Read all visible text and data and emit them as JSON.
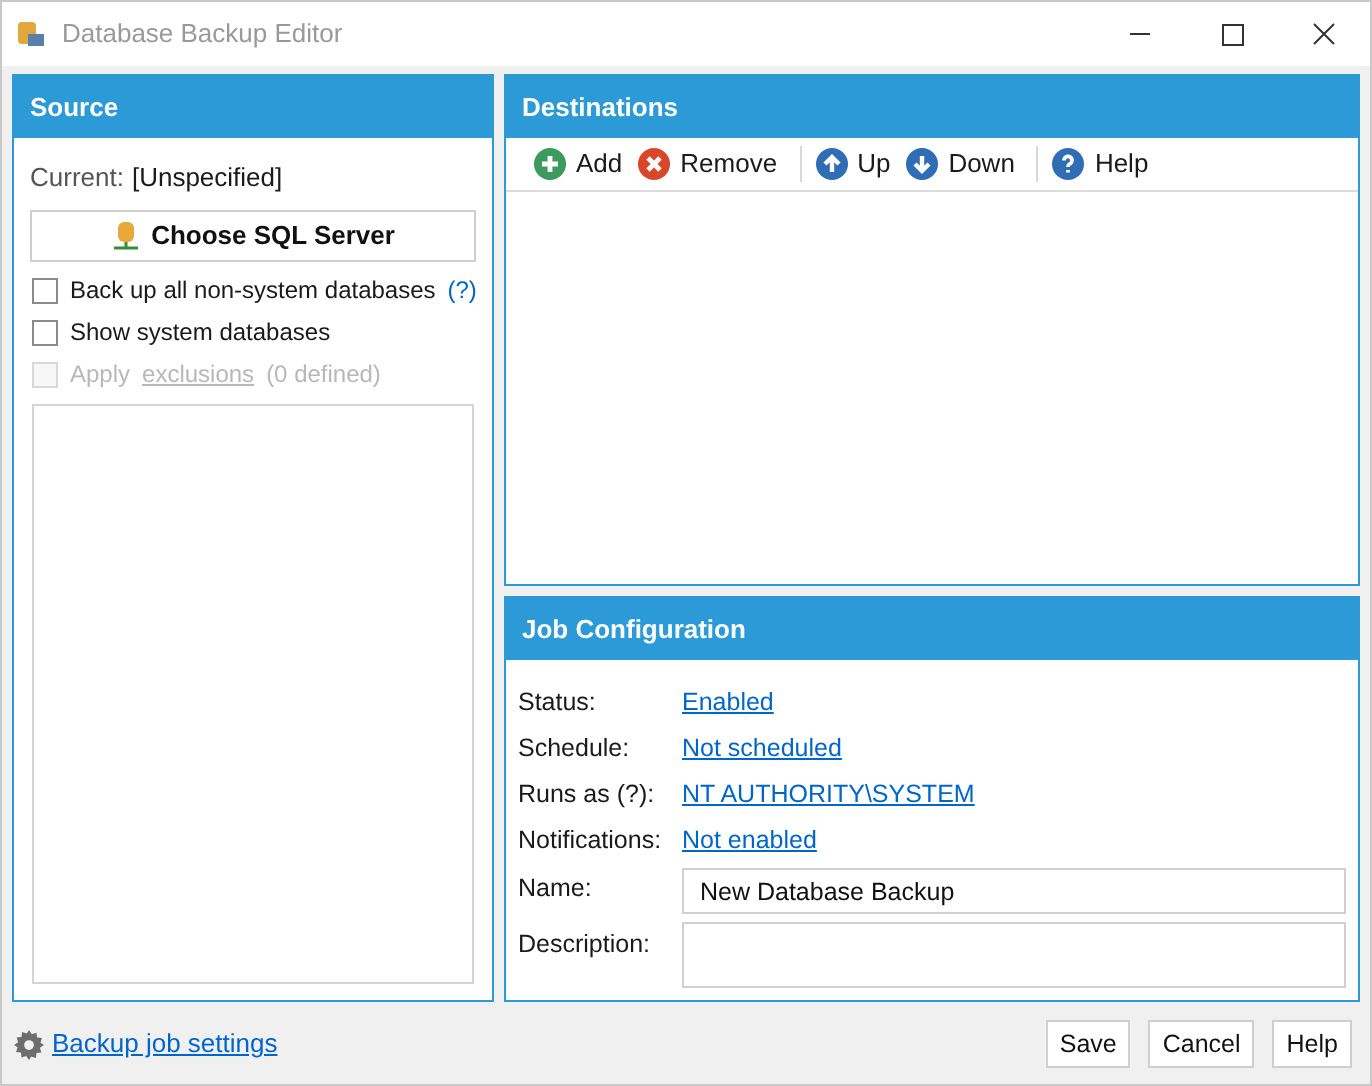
{
  "window": {
    "title": "Database Backup Editor"
  },
  "source": {
    "title": "Source",
    "current_label": "Current:",
    "current_value": "[Unspecified]",
    "choose_button": "Choose SQL Server",
    "options": [
      {
        "kind": "help",
        "label": "Back up all non-system databases",
        "help": "(?)",
        "checked": false,
        "disabled": false
      },
      {
        "kind": "plain",
        "label": "Show system databases",
        "checked": false,
        "disabled": false
      },
      {
        "kind": "link",
        "label": "Apply",
        "link": "exclusions",
        "suffix": "(0 defined)",
        "checked": false,
        "disabled": true
      }
    ]
  },
  "destinations": {
    "title": "Destinations",
    "toolbar": [
      {
        "kind": "add",
        "label": "Add",
        "separator_before": false
      },
      {
        "kind": "remove",
        "label": "Remove",
        "separator_before": false
      },
      {
        "kind": "up",
        "label": "Up",
        "separator_before": true
      },
      {
        "kind": "down",
        "label": "Down",
        "separator_before": false
      },
      {
        "kind": "help",
        "label": "Help",
        "separator_before": true
      }
    ]
  },
  "job_configuration": {
    "title": "Job Configuration",
    "links": [
      {
        "label": "Status:",
        "value": "Enabled"
      },
      {
        "label": "Schedule:",
        "value": "Not scheduled"
      },
      {
        "label": "Runs as (?):",
        "value": "NT AUTHORITY\\SYSTEM"
      },
      {
        "label": "Notifications:",
        "value": "Not enabled"
      }
    ],
    "name": {
      "label": "Name:",
      "value": "New Database Backup"
    },
    "description": {
      "label": "Description:"
    }
  },
  "footer": {
    "settings_link": "Backup job settings",
    "buttons": [
      "Save",
      "Cancel",
      "Help"
    ]
  }
}
